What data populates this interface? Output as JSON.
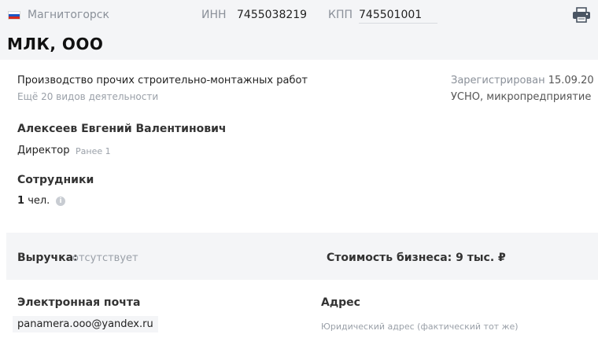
{
  "header": {
    "flag_colors": [
      "#ffffff",
      "#1c57c5",
      "#d52b1e"
    ],
    "city": "Магнитогорск",
    "inn_label": "ИНН",
    "inn_value": "7455038219",
    "kpp_label": "КПП",
    "kpp_value": "745501001",
    "print_icon": "printer-icon",
    "company_name": "МЛК, ООО"
  },
  "activity": {
    "main": "Производство прочих строительно-монтажных работ",
    "more": "Ещё 20 видов деятельности"
  },
  "registration": {
    "label": "Зарегистрирован",
    "date": "15.09.20",
    "tax": "УСНО, микропредприятие"
  },
  "director": {
    "name": "Алексеев Евгений Валентинович",
    "role": "Директор",
    "earlier": "Ранее 1"
  },
  "employees": {
    "title": "Сотрудники",
    "count": "1",
    "unit": "чел.",
    "info_icon": "info-icon"
  },
  "finance": {
    "revenue_label": "Выручка:",
    "revenue_value": "отсутствует",
    "business_value": "Стоимость бизнеса: 9 тыс. ₽"
  },
  "contacts": {
    "email_label": "Электронная почта",
    "email_value": "panamera.ooo@yandex.ru",
    "address_label": "Адрес",
    "address_value": "Юридический адрес (фактический тот же)"
  }
}
